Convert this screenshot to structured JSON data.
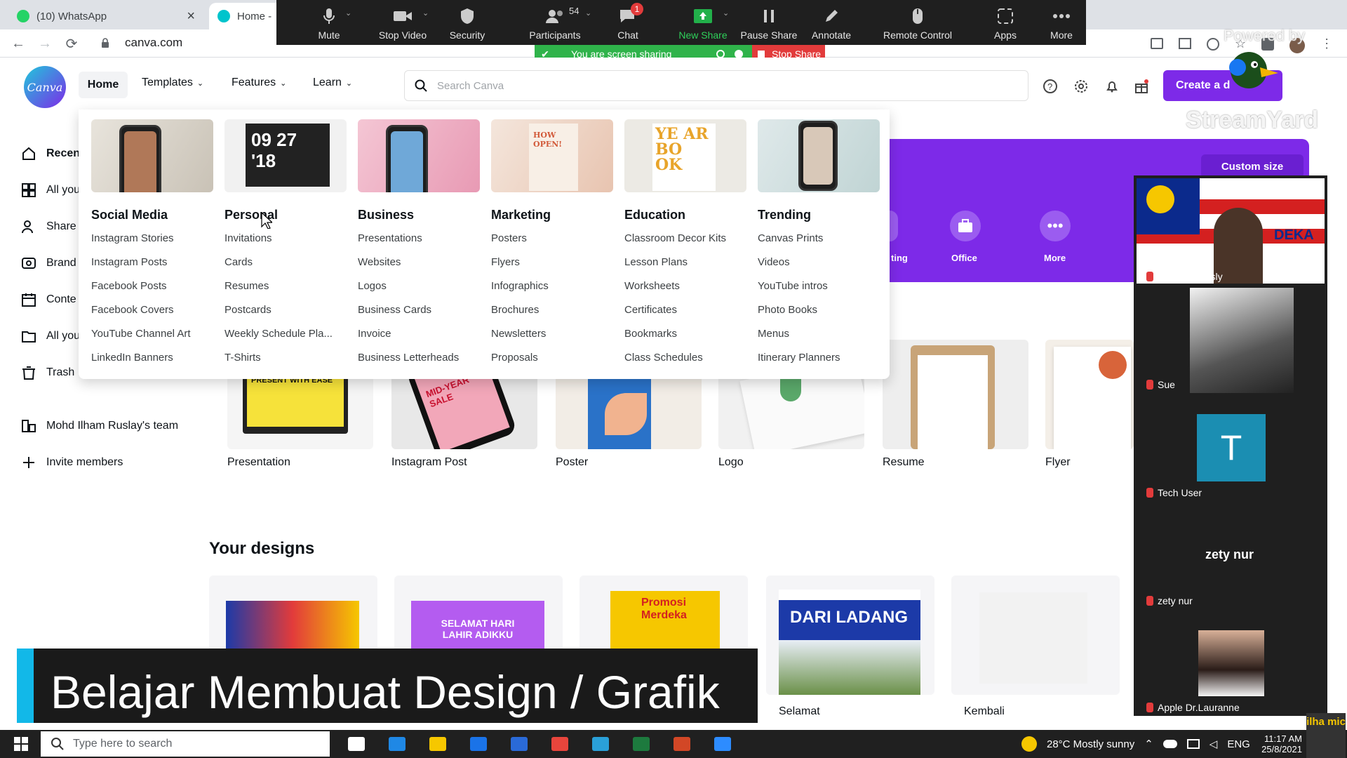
{
  "browser": {
    "tabs": [
      {
        "label": "(10) WhatsApp",
        "close": "×"
      },
      {
        "label": "Home -"
      }
    ],
    "url": "canva.com"
  },
  "zoom": {
    "toolbar": [
      {
        "label": "Mute",
        "icon": "mic-icon"
      },
      {
        "label": "Stop Video",
        "icon": "video-icon"
      },
      {
        "label": "Security",
        "icon": "shield-icon"
      },
      {
        "label": "Participants",
        "icon": "participants-icon",
        "count": "54"
      },
      {
        "label": "Chat",
        "icon": "chat-icon",
        "badge": "1"
      },
      {
        "label": "New Share",
        "icon": "share-icon"
      },
      {
        "label": "Pause Share",
        "icon": "pause-icon"
      },
      {
        "label": "Annotate",
        "icon": "pen-icon"
      },
      {
        "label": "Remote Control",
        "icon": "mouse-icon"
      },
      {
        "label": "Apps",
        "icon": "apps-icon"
      },
      {
        "label": "More",
        "icon": "more-icon"
      }
    ],
    "sharing_text": "You are screen sharing",
    "stop_share": "Stop Share",
    "participants": [
      {
        "name": "M. Ilham Rusly"
      },
      {
        "name": "Sue"
      },
      {
        "name": "Tech User",
        "initial": "T"
      },
      {
        "name": "zety nur",
        "big_name": "zety nur"
      },
      {
        "name": "Apple Dr.Lauranne"
      }
    ],
    "banner_text": "DEKA"
  },
  "canva": {
    "logo": "Canva",
    "nav": [
      "Home",
      "Templates",
      "Features",
      "Learn"
    ],
    "search_placeholder": "Search Canva",
    "create_button": "Create a d",
    "sidebar": [
      "Recen",
      "All you",
      "Share",
      "Brand",
      "Conte",
      "All you",
      "Trash",
      "Mohd Ilham Ruslay's team",
      "Invite members"
    ],
    "mega_menu": [
      {
        "title": "Social Media",
        "items": [
          "Instagram Stories",
          "Instagram Posts",
          "Facebook Posts",
          "Facebook Covers",
          "YouTube Channel Art",
          "LinkedIn Banners"
        ]
      },
      {
        "title": "Personal",
        "thumb_text": "09 27 '18",
        "items": [
          "Invitations",
          "Cards",
          "Resumes",
          "Postcards",
          "Weekly Schedule Pla...",
          "T-Shirts"
        ]
      },
      {
        "title": "Business",
        "items": [
          "Presentations",
          "Websites",
          "Logos",
          "Business Cards",
          "Invoice",
          "Business Letterheads"
        ]
      },
      {
        "title": "Marketing",
        "thumb_text": "HOW OPEN!",
        "items": [
          "Posters",
          "Flyers",
          "Infographics",
          "Brochures",
          "Newsletters",
          "Proposals"
        ]
      },
      {
        "title": "Education",
        "thumb_text": "YE AR BO OK",
        "items": [
          "Classroom Decor Kits",
          "Lesson Plans",
          "Worksheets",
          "Certificates",
          "Bookmarks",
          "Class Schedules"
        ]
      },
      {
        "title": "Trending",
        "items": [
          "Canvas Prints",
          "Videos",
          "YouTube intros",
          "Photo Books",
          "Menus",
          "Itinerary Planners"
        ]
      }
    ],
    "banner": {
      "custom_size": "Custom size",
      "icons": [
        {
          "label": "ting"
        },
        {
          "label": "Office"
        },
        {
          "label": "More"
        }
      ]
    },
    "templates": [
      {
        "label": "Presentation",
        "thumb_text": "PRESENT WITH EASE"
      },
      {
        "label": "Instagram Post",
        "thumb_text": "MID-YEAR SALE"
      },
      {
        "label": "Poster"
      },
      {
        "label": "Logo"
      },
      {
        "label": "Resume"
      },
      {
        "label": "Flyer"
      }
    ],
    "your_designs_title": "Your designs",
    "designs": [
      {
        "label": ""
      },
      {
        "label": "",
        "thumb_text": "SELAMAT HARI LAHIR ADIKKU"
      },
      {
        "label": "",
        "thumb_text": "Promosi Merdeka"
      },
      {
        "label": "Selamat",
        "thumb_text": "DARI LADANG"
      },
      {
        "label": "Kembali"
      }
    ]
  },
  "caption": "Belajar Membuat Design / Grafik",
  "streamyard": {
    "powered": "Powered by",
    "name": "StreamYard"
  },
  "taskbar": {
    "search_placeholder": "Type here to search",
    "weather": "28°C  Mostly sunny",
    "lang": "ENG",
    "time": "11:17 AM",
    "date": "25/8/2021",
    "corner": "ilha mic"
  }
}
